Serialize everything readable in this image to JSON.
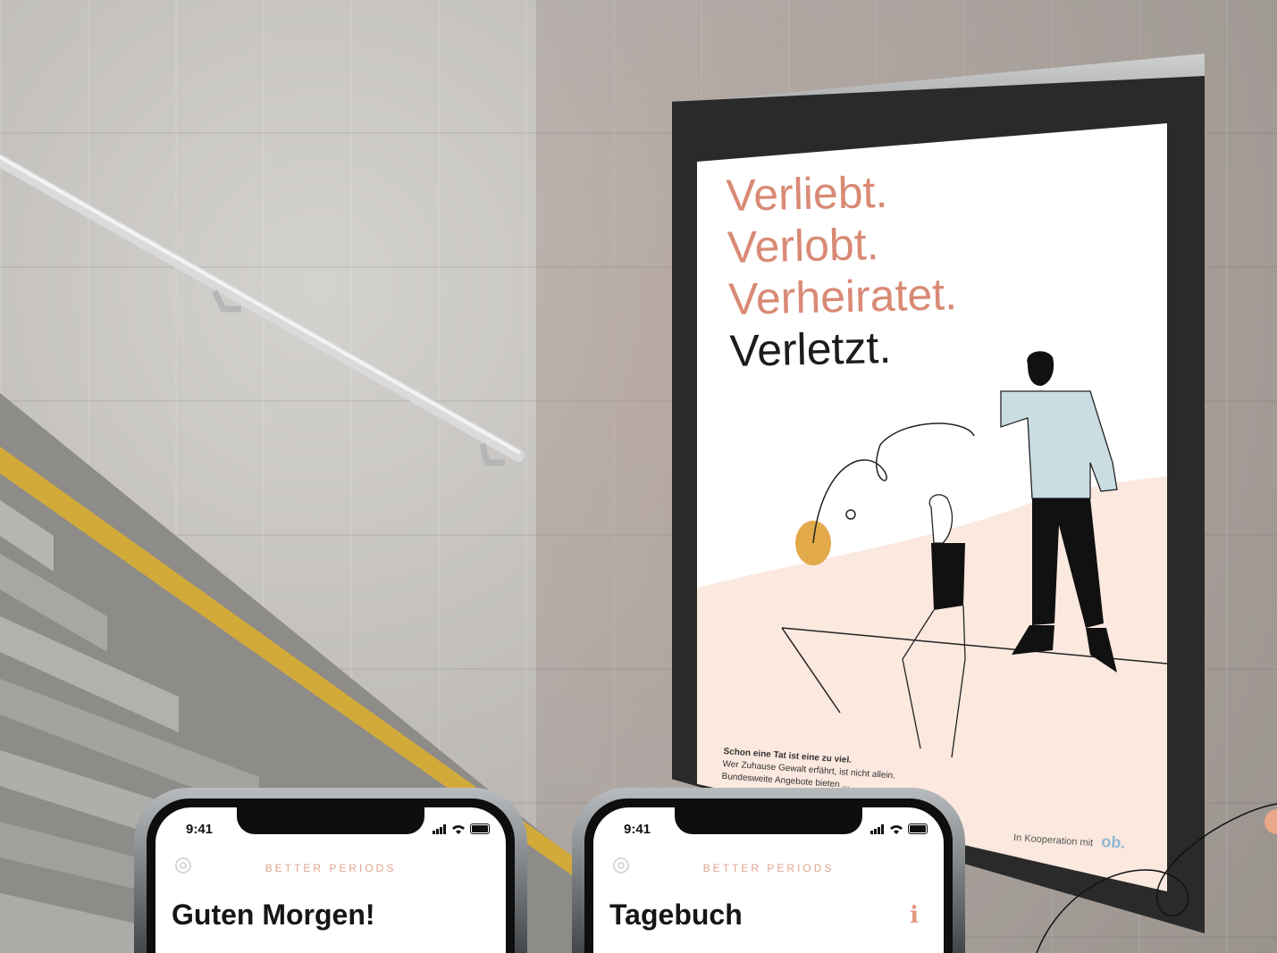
{
  "poster": {
    "headline": [
      "Verliebt.",
      "Verlobt.",
      "Verheiratet.",
      "Verletzt."
    ],
    "body_lines": [
      "Schon eine Tat ist eine zu viel.",
      "Wer Zuhause Gewalt erfährt, ist nicht allein.",
      "Bundesweite Angebote bieten ..."
    ],
    "cooperation": "In Kooperation mit",
    "logo_text": "ob."
  },
  "phones": [
    {
      "time": "9:41",
      "brand": "BETTER PERIODS",
      "title": "Guten Morgen!"
    },
    {
      "time": "9:41",
      "brand": "BETTER PERIODS",
      "title": "Tagebuch",
      "info_glyph": "i"
    }
  ],
  "colors": {
    "accent": "#d98a75",
    "brand": "#e0a58f",
    "poster_text": "#1c1c1c",
    "logo": "#8fb6d4"
  }
}
